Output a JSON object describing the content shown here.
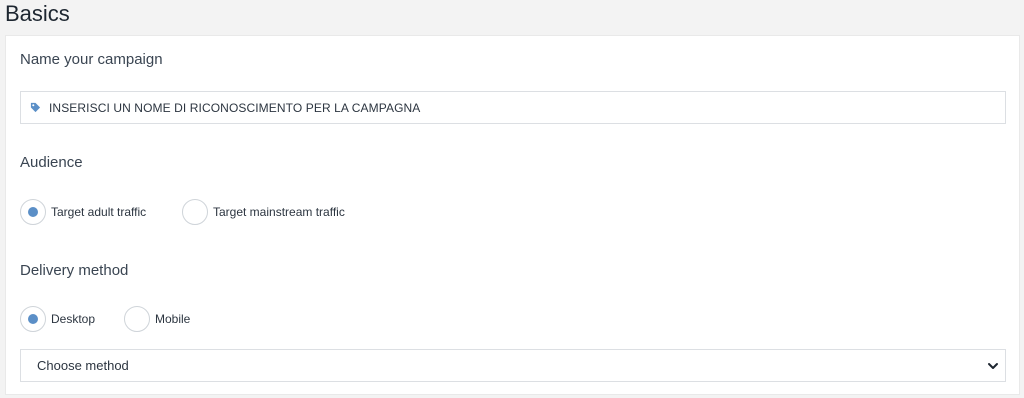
{
  "page": {
    "title": "Basics"
  },
  "campaign": {
    "label": "Name your campaign",
    "value": "INSERISCI UN NOME DI RICONOSCIMENTO PER LA CAMPAGNA",
    "icon": "tag-icon"
  },
  "audience": {
    "label": "Audience",
    "options": [
      {
        "label": "Target adult traffic",
        "selected": true
      },
      {
        "label": "Target mainstream traffic",
        "selected": false
      }
    ]
  },
  "delivery": {
    "label": "Delivery method",
    "options": [
      {
        "label": "Desktop",
        "selected": true
      },
      {
        "label": "Mobile",
        "selected": false
      }
    ],
    "select": {
      "value": "Choose method",
      "icon": "chevron-down-icon"
    }
  },
  "colors": {
    "accent": "#5b8fc7"
  }
}
